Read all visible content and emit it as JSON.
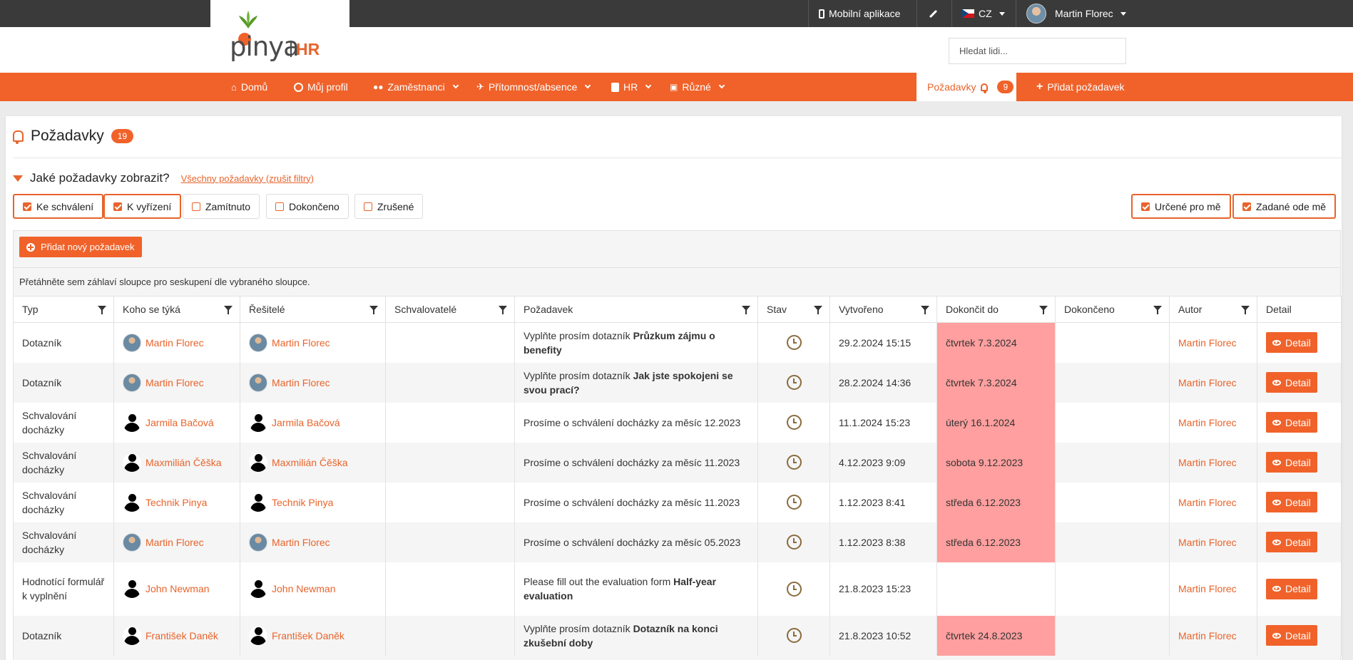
{
  "topbar": {
    "mobile_app": "Mobilní aplikace",
    "language": "CZ",
    "user_name": "Martin Florec"
  },
  "logo": {
    "name": "pinya",
    "suffix": "HR"
  },
  "search": {
    "placeholder": "Hledat lidi..."
  },
  "nav": {
    "home": "Domů",
    "profile": "Můj profil",
    "employees": "Zaměstnanci",
    "attendance": "Přítomnost/absence",
    "hr": "HR",
    "misc": "Různé",
    "requests": "Požadavky",
    "requests_count": "9",
    "add_request": "Přidat požadavek"
  },
  "page": {
    "title": "Požadavky",
    "count": "19",
    "filter_question": "Jaké požadavky zobrazit?",
    "filter_reset": "Všechny požadavky (zrušit filtry)",
    "add_new": "Přidat nový požadavek",
    "group_hint": "Přetáhněte sem záhlaví sloupce pro seskupení dle vybraného sloupce."
  },
  "filters": {
    "status": [
      {
        "label": "Ke schválení",
        "checked": true
      },
      {
        "label": "K vyřízení",
        "checked": true
      },
      {
        "label": "Zamítnuto",
        "checked": false
      },
      {
        "label": "Dokončeno",
        "checked": false
      },
      {
        "label": "Zrušené",
        "checked": false
      }
    ],
    "scope": [
      {
        "label": "Určené pro mě",
        "checked": true
      },
      {
        "label": "Zadané ode mě",
        "checked": true
      }
    ]
  },
  "table": {
    "columns": [
      "Typ",
      "Koho se týká",
      "Řešitelé",
      "Schvalovatelé",
      "Požadavek",
      "Stav",
      "Vytvořeno",
      "Dokončit do",
      "Dokončeno",
      "Autor",
      "Detail"
    ],
    "detail_label": "Detail",
    "rows": [
      {
        "type": "Dotazník",
        "subject": "Martin Florec",
        "subject_pic": "photo",
        "solver": "Martin Florec",
        "solver_pic": "photo",
        "approvers": "",
        "request_prefix": "Vyplňte prosím dotazník ",
        "request_bold": "Průzkum zájmu o benefity",
        "created": "29.2.2024 15:15",
        "due": "čtvrtek 7.3.2024",
        "completed": "",
        "author": "Martin Florec"
      },
      {
        "type": "Dotazník",
        "subject": "Martin Florec",
        "subject_pic": "photo",
        "solver": "Martin Florec",
        "solver_pic": "photo",
        "approvers": "",
        "request_prefix": "Vyplňte prosím dotazník ",
        "request_bold": "Jak jste spokojeni se svou prací?",
        "created": "28.2.2024 14:36",
        "due": "čtvrtek 7.3.2024",
        "completed": "",
        "author": "Martin Florec"
      },
      {
        "type": "Schvalování docházky",
        "subject": "Jarmila Bačová",
        "subject_pic": "silh",
        "solver": "Jarmila Bačová",
        "solver_pic": "silh",
        "approvers": "",
        "request_prefix": "Prosíme o schválení docházky za měsíc 12.2023",
        "request_bold": "",
        "created": "11.1.2024 15:23",
        "due": "úterý 16.1.2024",
        "completed": "",
        "author": "Martin Florec"
      },
      {
        "type": "Schvalování docházky",
        "subject": "Maxmilián Čěška",
        "subject_pic": "silh",
        "solver": "Maxmilián Čěška",
        "solver_pic": "silh",
        "approvers": "",
        "request_prefix": "Prosíme o schválení docházky za měsíc 11.2023",
        "request_bold": "",
        "created": "4.12.2023 9:09",
        "due": "sobota 9.12.2023",
        "completed": "",
        "author": "Martin Florec"
      },
      {
        "type": "Schvalování docházky",
        "subject": "Technik Pinya",
        "subject_pic": "silh",
        "solver": "Technik Pinya",
        "solver_pic": "silh",
        "approvers": "",
        "request_prefix": "Prosíme o schválení docházky za měsíc 11.2023",
        "request_bold": "",
        "created": "1.12.2023 8:41",
        "due": "středa 6.12.2023",
        "completed": "",
        "author": "Martin Florec"
      },
      {
        "type": "Schvalování docházky",
        "subject": "Martin Florec",
        "subject_pic": "photo",
        "solver": "Martin Florec",
        "solver_pic": "photo",
        "approvers": "",
        "request_prefix": "Prosíme o schválení docházky za měsíc 05.2023",
        "request_bold": "",
        "created": "1.12.2023 8:38",
        "due": "středa 6.12.2023",
        "completed": "",
        "author": "Martin Florec"
      },
      {
        "type": "Hodnotící formulář k vyplnění",
        "subject": "John Newman",
        "subject_pic": "silh",
        "solver": "John Newman",
        "solver_pic": "silh",
        "approvers": "",
        "request_prefix": "Please fill out the evaluation form ",
        "request_bold": "Half-year evaluation",
        "created": "21.8.2023 15:23",
        "due": "",
        "completed": "",
        "author": "Martin Florec"
      },
      {
        "type": "Dotazník",
        "subject": "František Daněk",
        "subject_pic": "silh",
        "solver": "František Daněk",
        "solver_pic": "silh",
        "approvers": "",
        "request_prefix": "Vyplňte prosím dotazník ",
        "request_bold": "Dotazník na konci zkušební doby",
        "created": "21.8.2023 10:52",
        "due": "čtvrtek 24.8.2023",
        "completed": "",
        "author": "Martin Florec"
      }
    ]
  },
  "colors": {
    "accent": "#f0622a",
    "due_highlight": "#ff9f9f",
    "topbar": "#3a3a3a"
  }
}
